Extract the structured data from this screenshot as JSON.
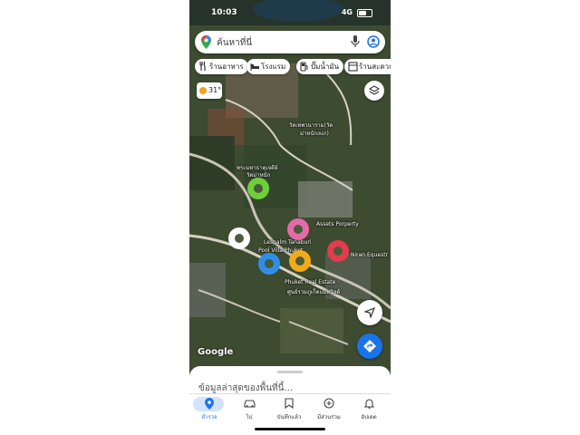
{
  "status_bar": {
    "time": "10:03",
    "network": "4G"
  },
  "search": {
    "placeholder": "ค้นหาที่นี่"
  },
  "chips": [
    {
      "label": "ร้านอาหาร",
      "icon": "restaurant-icon"
    },
    {
      "label": "โรงแรม",
      "icon": "hotel-icon"
    },
    {
      "label": "ปั๊มน้ำมัน",
      "icon": "gas-station-icon"
    },
    {
      "label": "ร้านสะดวกซื้",
      "icon": "convenience-store-icon"
    }
  ],
  "weather": {
    "temperature": "31°",
    "icon": "sun-icon"
  },
  "map_labels": [
    "วัดเทพวนาราม(วัด",
    "ม่าหนักงแก)",
    "พระมหาธาตุเจดีย์",
    "วัดม่าหนัก",
    "Assets Porperty",
    "Lespalm Tanaburi",
    "Pool Villa Phuket",
    "Niran Equestr",
    "Phuket Real Estate",
    "ศูนย์รวมภูเก็ตแมทวิลด์"
  ],
  "markers": [
    {
      "color": "#6fcf3b"
    },
    {
      "color": "#ffffff"
    },
    {
      "color": "#e56aa8"
    },
    {
      "color": "#e23c4e"
    },
    {
      "color": "#2f8fe8"
    },
    {
      "color": "#f1ab1a"
    }
  ],
  "map_branding": "Google",
  "sheet": {
    "title": "ข้อมูลล่าสุดของพื้นที่นี้..."
  },
  "tabs": [
    {
      "label": "สำรวจ",
      "icon": "explore-pin-icon",
      "active": true
    },
    {
      "label": "ไป",
      "icon": "car-icon"
    },
    {
      "label": "บันทึกแล้ว",
      "icon": "bookmark-icon"
    },
    {
      "label": "มีส่วนร่วม",
      "icon": "add-circle-icon"
    },
    {
      "label": "อัปเดต",
      "icon": "bell-icon"
    }
  ],
  "colors": {
    "accent": "#1a73e8",
    "active_tab_bg": "#d3e3fd"
  }
}
